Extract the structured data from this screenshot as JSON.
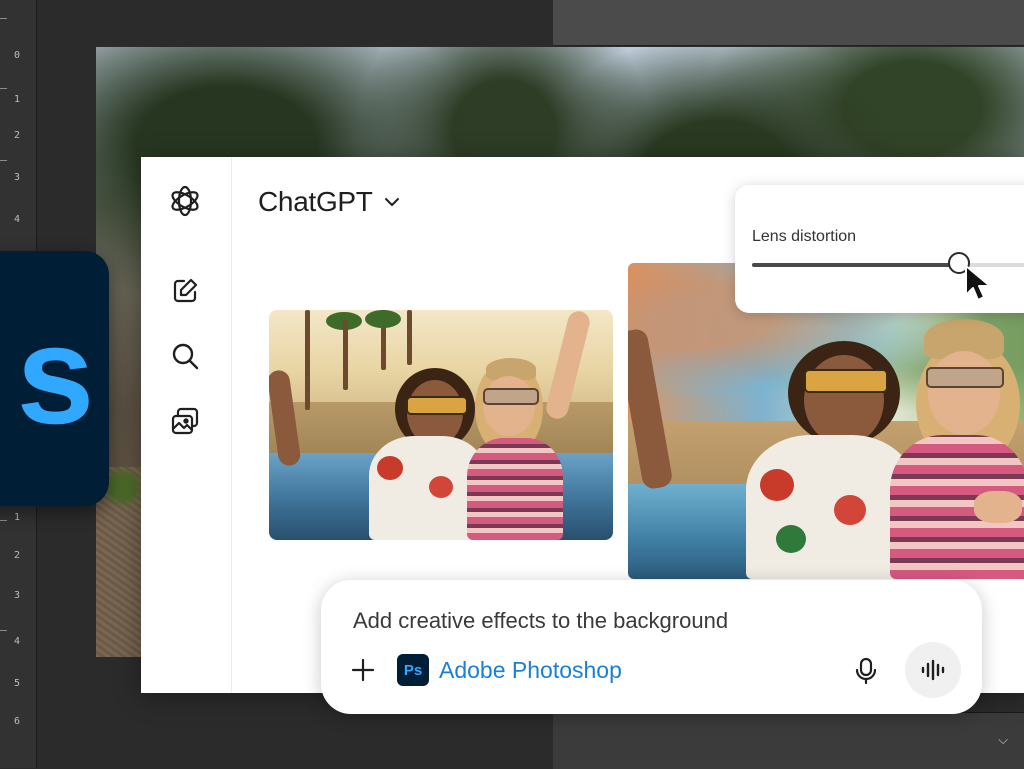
{
  "photoshop": {
    "logo_letter": "s",
    "ruler_ticks": [
      "0",
      "1",
      "2",
      "3",
      "4",
      "1",
      "2",
      "3",
      "4",
      "5",
      "6"
    ],
    "dropdown_glyph": "⌵"
  },
  "chat": {
    "title": "ChatGPT",
    "sidebar_icons": [
      "openai-logo-icon",
      "new-chat-icon",
      "search-icon",
      "images-icon"
    ]
  },
  "slider": {
    "label": "Lens distortion",
    "value_fraction": 0.73
  },
  "prompt": {
    "text": "Add creative effects to the background",
    "app_icon_text": "Ps",
    "app_name": "Adobe Photoshop"
  },
  "colors": {
    "ps_dark": "#001e36",
    "ps_blue": "#31a8ff",
    "link_blue": "#1a7fd8"
  }
}
